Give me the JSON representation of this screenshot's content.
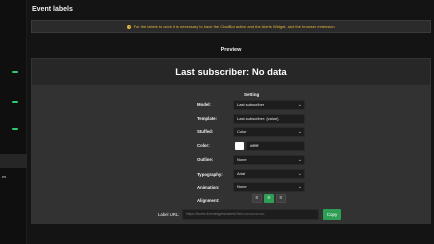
{
  "header": {
    "title": "Event labels"
  },
  "alert": {
    "text": "For the labels to work it is necessary to have the ChatBot active and the Alerts Widget, and the browser extension"
  },
  "sidebar": {
    "bottom_label": "es"
  },
  "preview": {
    "label": "Preview",
    "text": "Last subscriber: No data"
  },
  "settings": {
    "title": "Setting",
    "model": {
      "label": "Model:",
      "value": "Last subscriber"
    },
    "template": {
      "label": "Template:",
      "value": "Last subscriber: {value}"
    },
    "stuffed": {
      "label": "Stuffed:",
      "value": "Color"
    },
    "color": {
      "label": "Color:",
      "value": "#ffffff"
    },
    "outline": {
      "label": "Outline:",
      "value": "None"
    },
    "typography": {
      "label": "Typography:",
      "value": "Arial"
    },
    "animation": {
      "label": "Animation:",
      "value": "None"
    },
    "alignment": {
      "label": "Alignment:",
      "selected": "center"
    }
  },
  "url": {
    "label": "Label URL:",
    "value": "https://botrix.live/widgets/labels?bid=••••••••••••••••"
  },
  "copy": {
    "label": "Copy"
  },
  "colors": {
    "accent": "#2e9e55",
    "warning": "#e5b73b"
  },
  "icons": {
    "chevron": "chevron-down-icon",
    "align_left": "align-left-icon",
    "align_center": "align-center-icon",
    "align_right": "align-right-icon",
    "info": "info-icon"
  }
}
